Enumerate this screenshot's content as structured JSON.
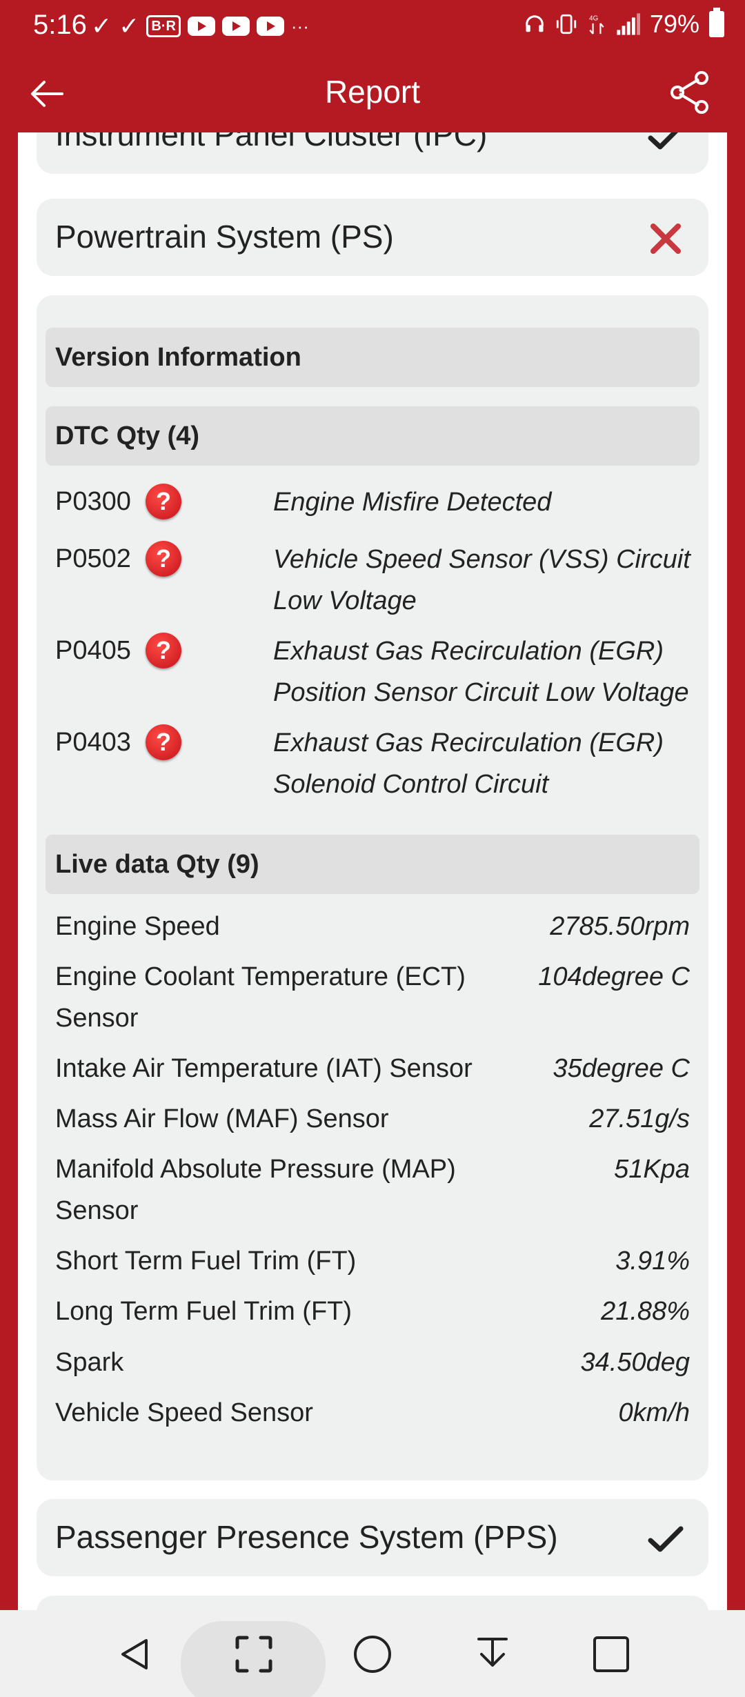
{
  "status_bar": {
    "time": "5:16",
    "check_marks": [
      "✓",
      "✓"
    ],
    "br_badge": "B·R",
    "more": "···",
    "battery": "79%"
  },
  "app_bar": {
    "title": "Report",
    "back_icon": "arrow-left-icon",
    "share_icon": "share-icon"
  },
  "systems": [
    {
      "name": "Instrument Panel Cluster (IPC)",
      "status": "pass"
    },
    {
      "name": "Powertrain System (PS)",
      "status": "fail"
    },
    {
      "name": "Passenger Presence System (PPS)",
      "status": "pass"
    }
  ],
  "powertrain_details": {
    "version_header": "Version Information",
    "dtc_header": "DTC Qty (4)",
    "dtcs": [
      {
        "code": "P0300",
        "desc_lines": [
          "Engine Misfire Detected"
        ]
      },
      {
        "code": "P0502",
        "desc_lines": [
          "Vehicle Speed Sensor (VSS) Circuit",
          "Low Voltage"
        ]
      },
      {
        "code": "P0405",
        "desc_lines": [
          "Exhaust Gas Recirculation (EGR)",
          "Position Sensor Circuit Low Voltage"
        ]
      },
      {
        "code": "P0403",
        "desc_lines": [
          "Exhaust Gas Recirculation (EGR)",
          "Solenoid Control Circuit"
        ]
      }
    ],
    "help_icon_text": "?",
    "live_header": "Live data Qty (9)",
    "live_data": [
      {
        "label_lines": [
          "Engine Speed"
        ],
        "value": "2785.50rpm"
      },
      {
        "label_lines": [
          "Engine Coolant Temperature (ECT)",
          "Sensor"
        ],
        "value": "104degree C"
      },
      {
        "label_lines": [
          "Intake Air Temperature (IAT) Sensor"
        ],
        "value": "35degree C"
      },
      {
        "label_lines": [
          "Mass Air Flow (MAF) Sensor"
        ],
        "value": "27.51g/s"
      },
      {
        "label_lines": [
          "Manifold Absolute Pressure (MAP)",
          "Sensor"
        ],
        "value": "51Kpa"
      },
      {
        "label_lines": [
          "Short Term Fuel Trim (FT)"
        ],
        "value": "3.91%"
      },
      {
        "label_lines": [
          "Long Term Fuel Trim (FT)"
        ],
        "value": "21.88%"
      },
      {
        "label_lines": [
          "Spark"
        ],
        "value": "34.50deg"
      },
      {
        "label_lines": [
          "Vehicle Speed Sensor"
        ],
        "value": "0km/h"
      }
    ]
  },
  "colors": {
    "brand_red": "#b51a22",
    "card_bg": "#eff0f0",
    "header_bg": "#e0e0e0",
    "fail_x": "#c8383e",
    "pass_check": "#222222"
  },
  "nav_bar": {
    "buttons": [
      "back-triangle-icon",
      "screenshot-frame-icon",
      "home-circle-icon",
      "download-icon",
      "recents-square-icon"
    ]
  }
}
